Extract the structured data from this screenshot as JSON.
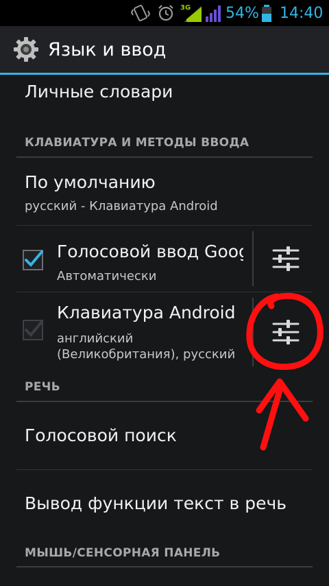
{
  "status_bar": {
    "network": "3G",
    "battery": "54%",
    "time": "14:40"
  },
  "action_bar": {
    "title": "Язык и ввод",
    "icon": "settings-gear-icon"
  },
  "list": {
    "personal_dictionary": "Личные словари",
    "section_keyboard": "КЛАВИАТУРА И МЕТОДЫ ВВОДА",
    "default": {
      "title": "По умолчанию",
      "summary": "русский - Клавиатура Android"
    },
    "voice_input": {
      "title": "Голосовой ввод Goog",
      "summary": "Автоматически",
      "checked": true
    },
    "android_keyboard": {
      "title": "Клавиатура Android",
      "summary_line1": "английский",
      "summary_line2": "(Великобритания), русский",
      "checked": true,
      "enabled": false
    },
    "section_speech": "РЕЧЬ",
    "voice_search": "Голосовой поиск",
    "tts": "Вывод функции текст в речь",
    "section_mouse": "МЫШЬ/СЕНСОРНАЯ ПАНЕЛЬ"
  },
  "colors": {
    "accent": "#33b5e5",
    "annotation": "#ff0000"
  }
}
